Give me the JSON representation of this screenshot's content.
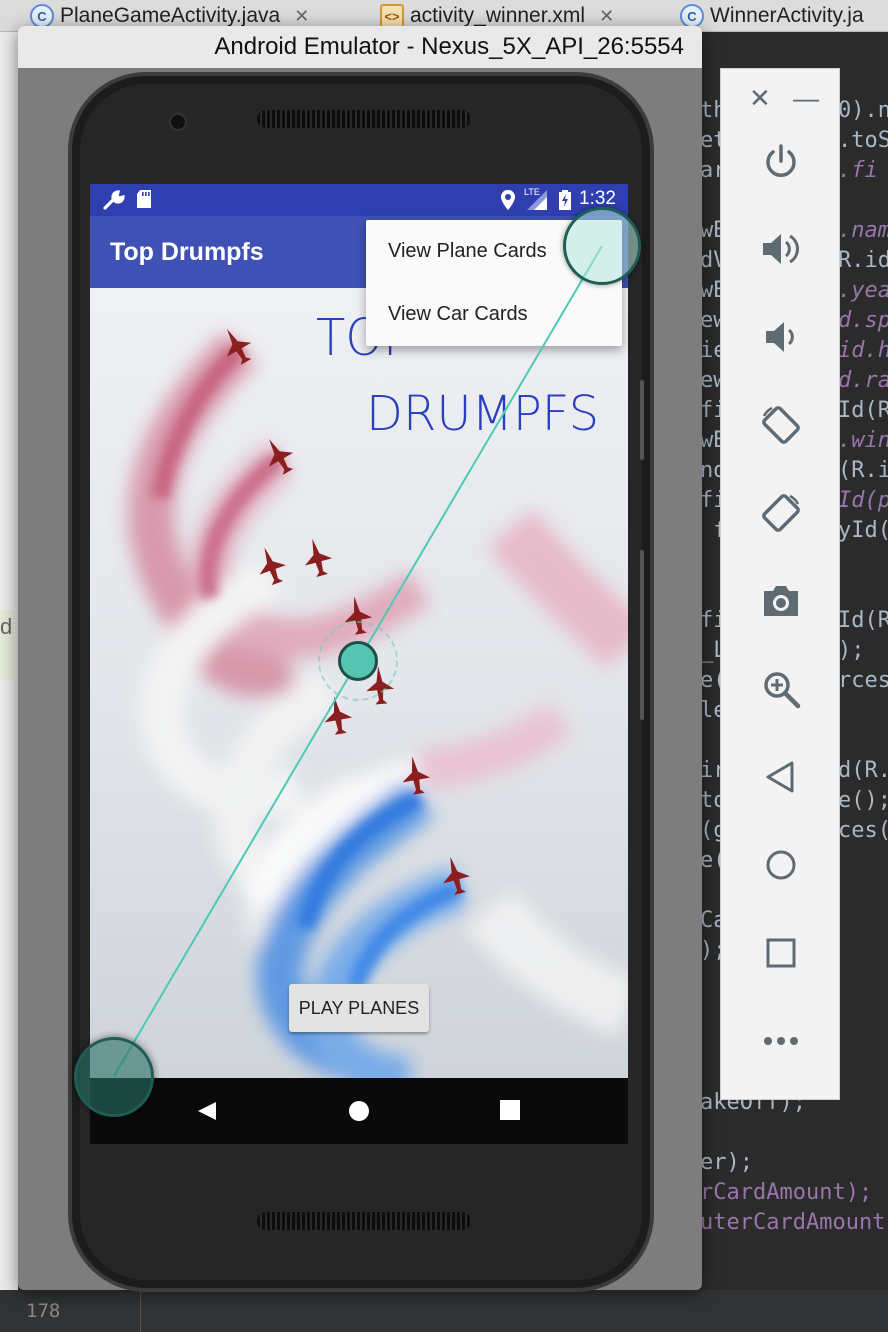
{
  "ide": {
    "tabs": [
      {
        "icon": "C",
        "label": "PlaneGameActivity.java"
      },
      {
        "icon": "<>",
        "label": "activity_winner.xml"
      },
      {
        "icon": "C",
        "label": "WinnerActivity.ja"
      }
    ],
    "line_number": "178",
    "left_peek": "d",
    "code_lines": [
      {
        "plain": "th",
        "right": "0).n"
      },
      {
        "plain": "et",
        "right": ".toS"
      },
      {
        "plain": "ar",
        "right": ".fi"
      },
      {
        "plain": "",
        "right": ""
      },
      {
        "plain": "wB",
        "right": ".nam"
      },
      {
        "plain": "dV",
        "right": "R.id"
      },
      {
        "plain": "wB",
        "right": ".yea"
      },
      {
        "plain": "ew",
        "right": "d.sp"
      },
      {
        "plain": "ie",
        "right": "id.h"
      },
      {
        "plain": "ew",
        "right": "d.ra"
      },
      {
        "plain": "fi",
        "right": "Id(R"
      },
      {
        "plain": "wB",
        "right": ".win"
      },
      {
        "plain": "nd",
        "right": "(R.i"
      },
      {
        "plain": "fi",
        "right": "Id(p"
      },
      {
        "plain": " f",
        "right": "yId("
      }
    ],
    "code_lines2": [
      {
        "plain": "fi",
        "right": "Id(R"
      },
      {
        "plain": "_L",
        "right": ");"
      },
      {
        "plain": "e(",
        "right": "rces"
      },
      {
        "plain": "le",
        "right": ""
      },
      {
        "plain": "",
        "right": ""
      },
      {
        "plain": "ir",
        "right": "d(R."
      },
      {
        "plain": "to",
        "right": "e();"
      },
      {
        "plain": "(g",
        "right": "ces("
      },
      {
        "plain": "e(",
        "right": ""
      },
      {
        "plain": "",
        "right": ""
      },
      {
        "plain": "Ca",
        "right": ""
      },
      {
        "plain": ");",
        "right": ""
      }
    ],
    "code_lower": [
      "akeOff);",
      "",
      "er);",
      "rCardAmount);",
      "uterCardAmount"
    ]
  },
  "emulator": {
    "title": "Android Emulator - Nexus_5X_API_26:5554",
    "status_time": "1:32",
    "status_lte": "LTE",
    "app_title": "Top Drumpfs",
    "logo_line1": "TOP",
    "logo_line2": "DRUMPFS",
    "play_button": "PLAY PLANES",
    "menu_items": [
      "View Plane Cards",
      "View Car Cards"
    ],
    "toolbar": [
      "close-icon",
      "minimize-icon",
      "power-icon",
      "volume-up-icon",
      "volume-down-icon",
      "rotate-left-icon",
      "rotate-right-icon",
      "camera-icon",
      "zoom-icon",
      "back-icon",
      "home-icon",
      "overview-icon",
      "more-icon"
    ]
  },
  "colors": {
    "status_bar": "#2f3fb0",
    "app_bar": "#3f51b5",
    "logo_text": "#2a3fbf",
    "touch_indicator": "#55c4b0"
  }
}
